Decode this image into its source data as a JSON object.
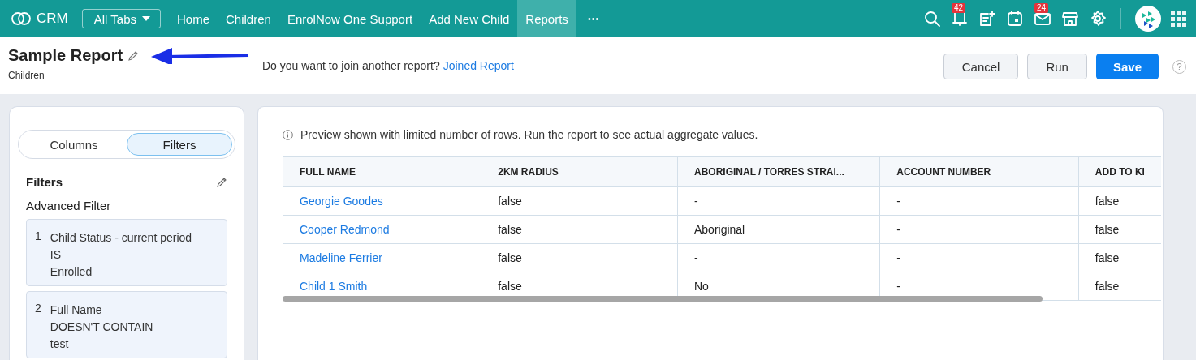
{
  "topbar": {
    "app_name": "CRM",
    "all_tabs": "All Tabs",
    "tabs": [
      {
        "label": "Home",
        "selected": false
      },
      {
        "label": "Children",
        "selected": false
      },
      {
        "label": "EnrolNow One Support",
        "selected": false
      },
      {
        "label": "Add New Child",
        "selected": false
      },
      {
        "label": "Reports",
        "selected": true
      }
    ],
    "more": "•••",
    "badges": {
      "notifications": "42",
      "mail": "24"
    }
  },
  "header": {
    "title": "Sample Report",
    "module": "Children",
    "join_prompt": "Do you want to join another report?",
    "join_link": "Joined Report",
    "buttons": [
      {
        "label": "Cancel",
        "kind": "secondary"
      },
      {
        "label": "Run",
        "kind": "secondary"
      },
      {
        "label": "Save",
        "kind": "primary"
      }
    ],
    "help": "?"
  },
  "sidebar": {
    "toggle": [
      {
        "label": "Columns",
        "selected": false
      },
      {
        "label": "Filters",
        "selected": true
      }
    ],
    "heading": "Filters",
    "subheading": "Advanced Filter",
    "filters": [
      {
        "number": "1",
        "field": "Child Status - current period",
        "operator": "IS",
        "value": "Enrolled"
      },
      {
        "number": "2",
        "field": "Full Name",
        "operator": "DOESN'T CONTAIN",
        "value": "test"
      }
    ]
  },
  "preview": {
    "notice": "Preview shown with limited number of rows. Run the report to see actual aggregate values.",
    "table": {
      "columns": [
        "FULL NAME",
        "2KM RADIUS",
        "ABORIGINAL / TORRES STRAI...",
        "ACCOUNT NUMBER",
        "ADD TO KI"
      ],
      "rows": [
        [
          "Georgie Goodes",
          "false",
          "-",
          "-",
          "false"
        ],
        [
          "Cooper Redmond",
          "false",
          "Aboriginal",
          "-",
          "false"
        ],
        [
          "Madeline Ferrier",
          "false",
          "-",
          "-",
          "false"
        ],
        [
          "Child 1 Smith",
          "false",
          "No",
          "-",
          "false"
        ]
      ]
    }
  }
}
